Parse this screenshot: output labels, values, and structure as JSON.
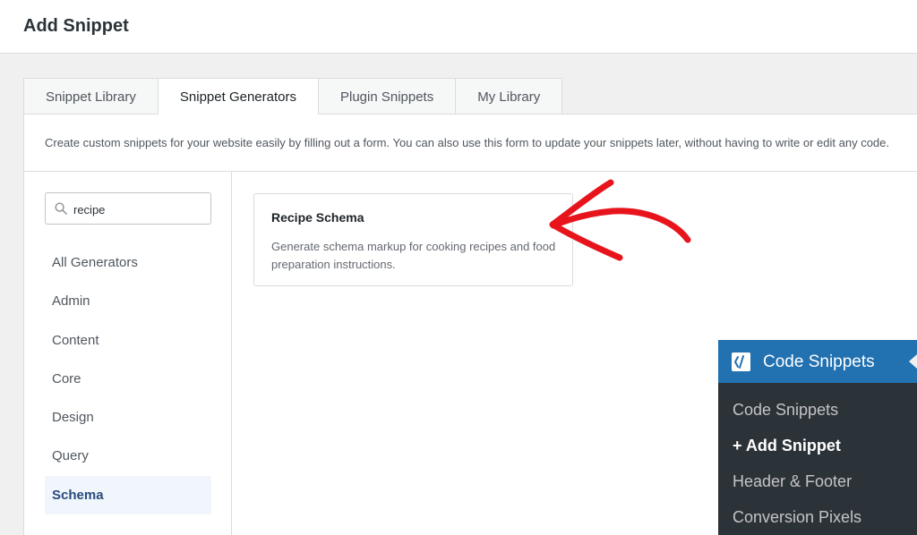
{
  "header": {
    "title": "Add Snippet"
  },
  "tabs": [
    {
      "label": "Snippet Library"
    },
    {
      "label": "Snippet Generators"
    },
    {
      "label": "Plugin Snippets"
    },
    {
      "label": "My Library"
    }
  ],
  "active_tab": "Snippet Generators",
  "description": "Create custom snippets for your website easily by filling out a form. You can also use this form to update your snippets later, without having to write or edit any code.",
  "search": {
    "value": "recipe"
  },
  "categories": [
    {
      "label": "All Generators"
    },
    {
      "label": "Admin"
    },
    {
      "label": "Content"
    },
    {
      "label": "Core"
    },
    {
      "label": "Design"
    },
    {
      "label": "Query"
    },
    {
      "label": "Schema"
    }
  ],
  "active_category": "Schema",
  "results": [
    {
      "title": "Recipe Schema",
      "description": "Generate schema markup for cooking recipes and food preparation instructions."
    }
  ],
  "wp_menu": {
    "title": "Code Snippets",
    "items": [
      {
        "label": "Code Snippets"
      },
      {
        "label": "+ Add Snippet"
      },
      {
        "label": "Header & Footer"
      },
      {
        "label": "Conversion Pixels"
      }
    ],
    "current": "+ Add Snippet"
  },
  "colors": {
    "accent": "#2271b1",
    "arrow": "#e8141c",
    "menu_bg": "#2c3338"
  }
}
